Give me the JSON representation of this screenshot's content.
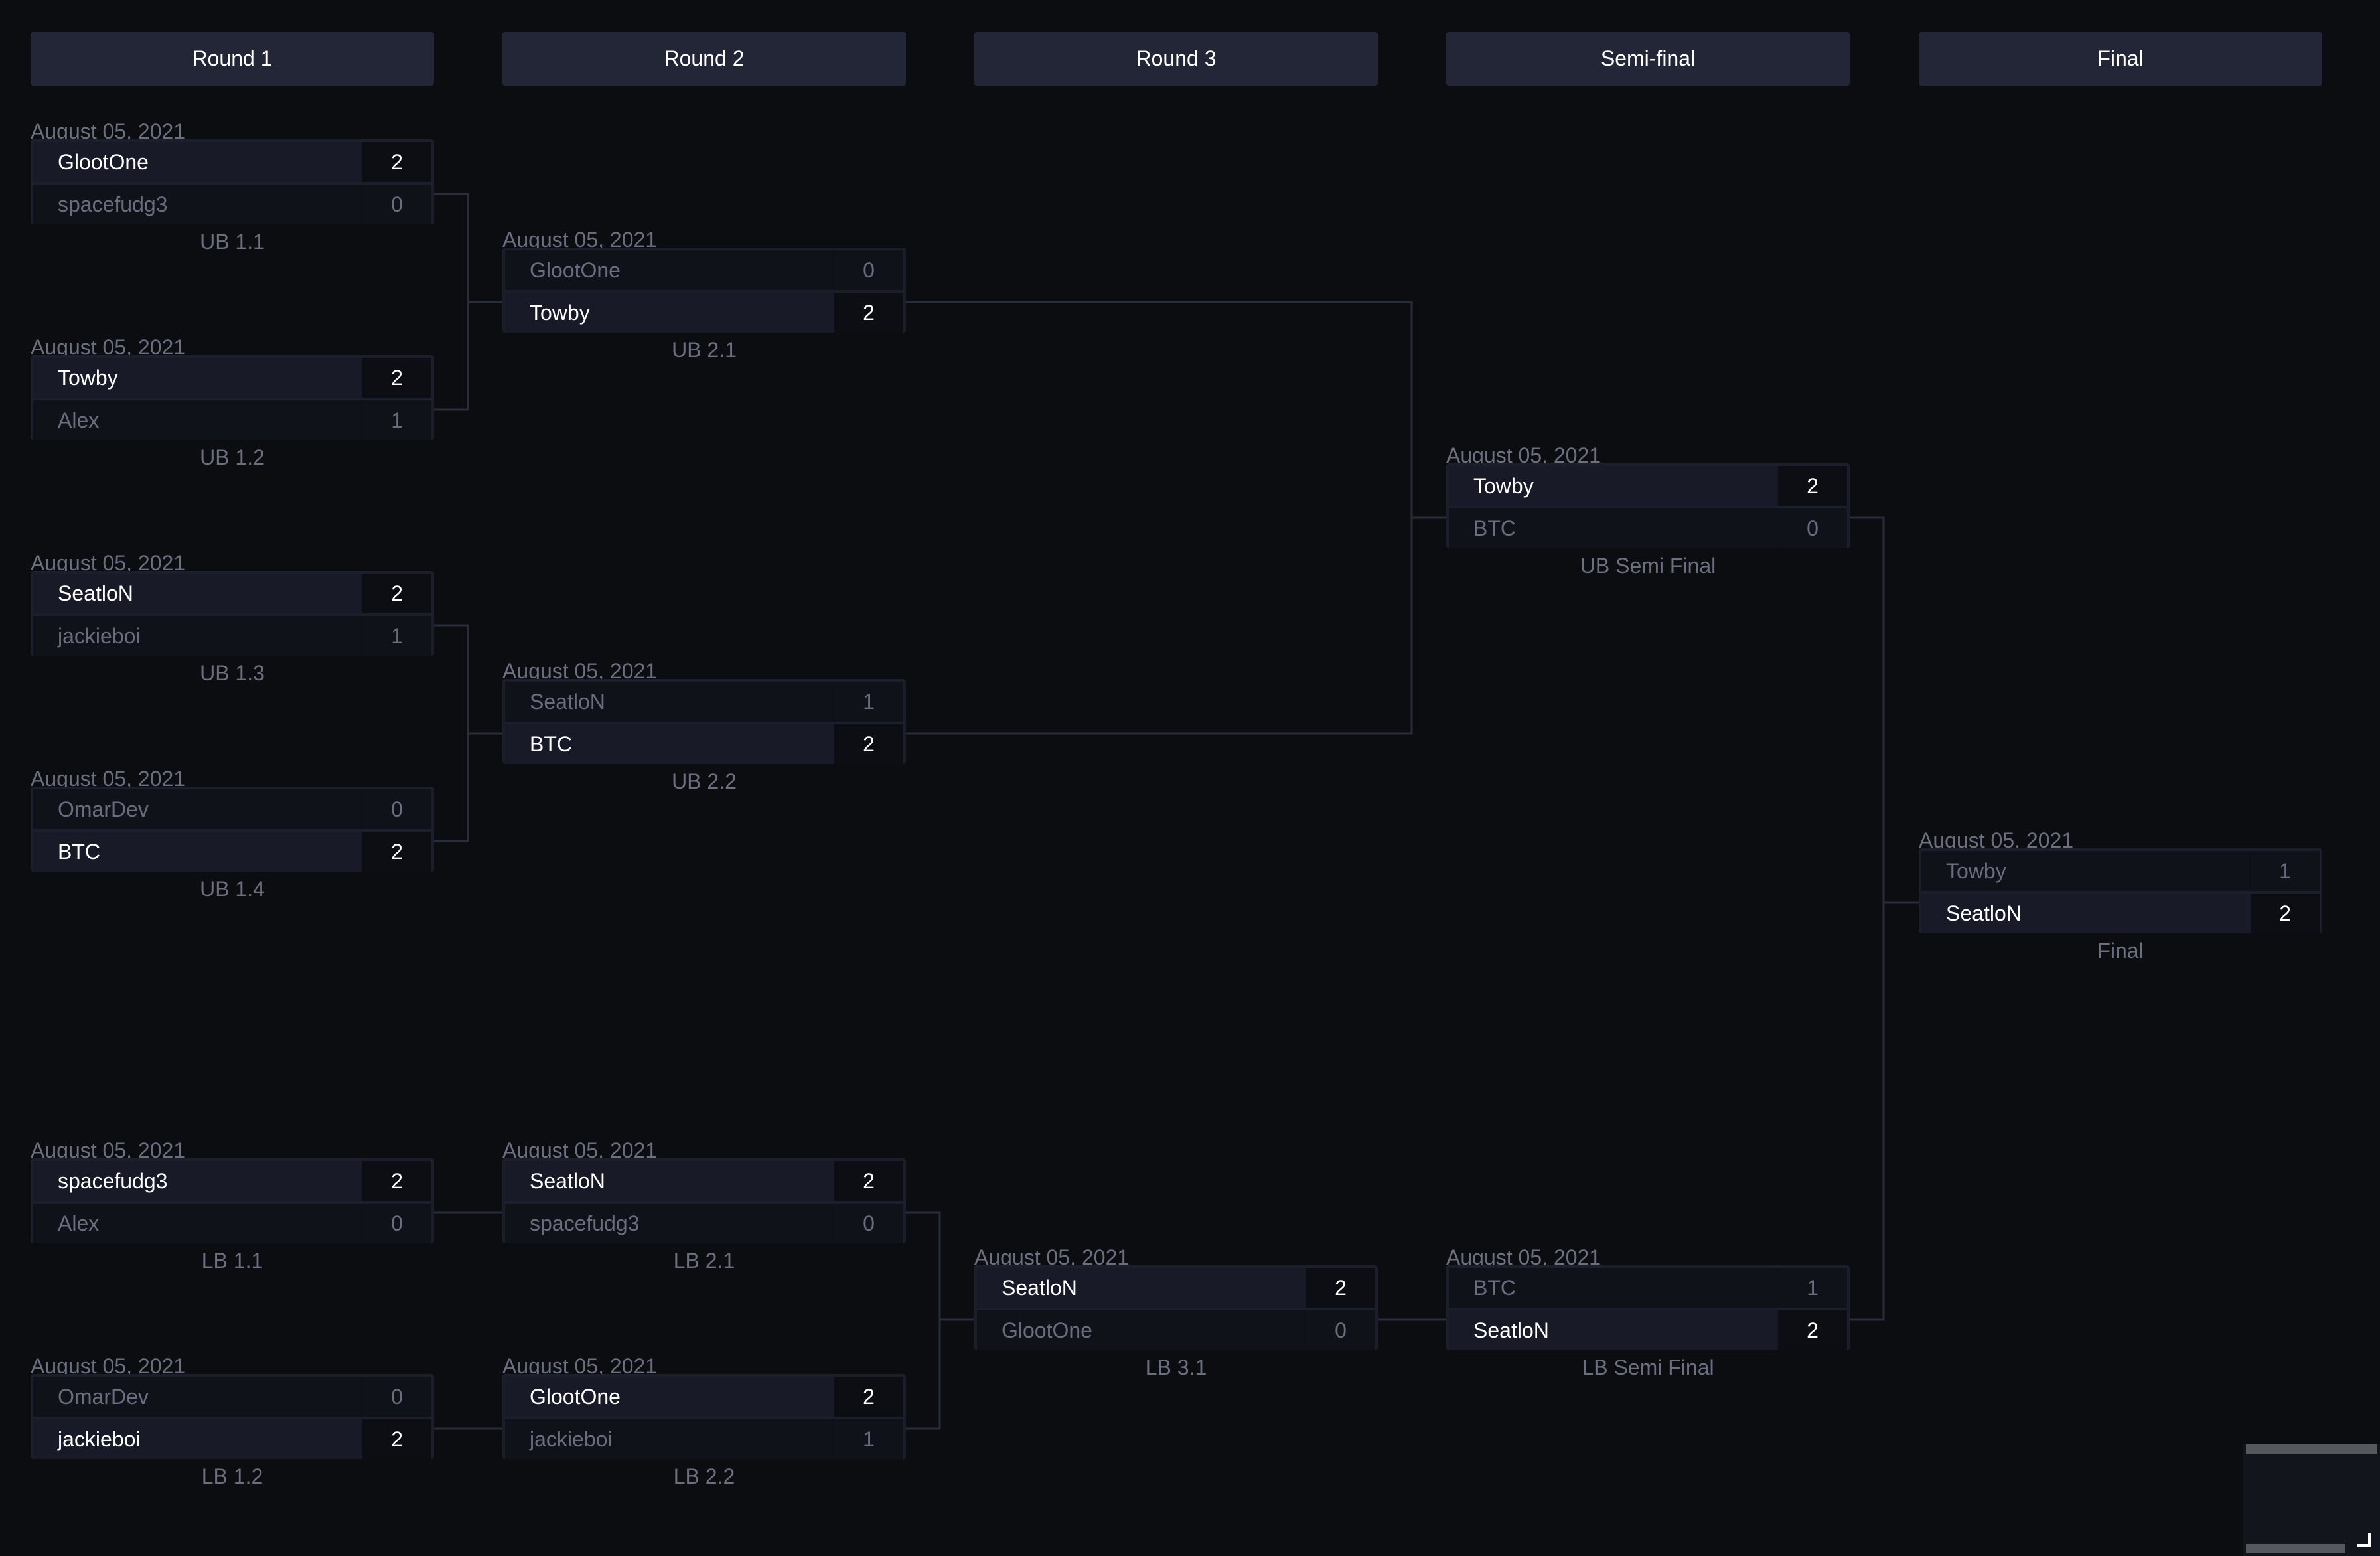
{
  "rounds": [
    "Round 1",
    "Round 2",
    "Round 3",
    "Semi-final",
    "Final"
  ],
  "matches": {
    "ub11": {
      "date": "August 05, 2021",
      "label": "UB 1.1",
      "p1": {
        "name": "GlootOne",
        "score": "2",
        "win": true
      },
      "p2": {
        "name": "spacefudg3",
        "score": "0",
        "win": false
      }
    },
    "ub12": {
      "date": "August 05, 2021",
      "label": "UB 1.2",
      "p1": {
        "name": "Towby",
        "score": "2",
        "win": true
      },
      "p2": {
        "name": "Alex",
        "score": "1",
        "win": false
      }
    },
    "ub13": {
      "date": "August 05, 2021",
      "label": "UB 1.3",
      "p1": {
        "name": "SeatloN",
        "score": "2",
        "win": true
      },
      "p2": {
        "name": "jackieboi",
        "score": "1",
        "win": false
      }
    },
    "ub14": {
      "date": "August 05, 2021",
      "label": "UB 1.4",
      "p1": {
        "name": "OmarDev",
        "score": "0",
        "win": false
      },
      "p2": {
        "name": "BTC",
        "score": "2",
        "win": true
      }
    },
    "ub21": {
      "date": "August 05, 2021",
      "label": "UB 2.1",
      "p1": {
        "name": "GlootOne",
        "score": "0",
        "win": false
      },
      "p2": {
        "name": "Towby",
        "score": "2",
        "win": true
      }
    },
    "ub22": {
      "date": "August 05, 2021",
      "label": "UB 2.2",
      "p1": {
        "name": "SeatloN",
        "score": "1",
        "win": false
      },
      "p2": {
        "name": "BTC",
        "score": "2",
        "win": true
      }
    },
    "ubsf": {
      "date": "August 05, 2021",
      "label": "UB Semi Final",
      "p1": {
        "name": "Towby",
        "score": "2",
        "win": true
      },
      "p2": {
        "name": "BTC",
        "score": "0",
        "win": false
      }
    },
    "final": {
      "date": "August 05, 2021",
      "label": "Final",
      "p1": {
        "name": "Towby",
        "score": "1",
        "win": false
      },
      "p2": {
        "name": "SeatloN",
        "score": "2",
        "win": true
      }
    },
    "lb11": {
      "date": "August 05, 2021",
      "label": "LB 1.1",
      "p1": {
        "name": "spacefudg3",
        "score": "2",
        "win": true
      },
      "p2": {
        "name": "Alex",
        "score": "0",
        "win": false
      }
    },
    "lb12": {
      "date": "August 05, 2021",
      "label": "LB 1.2",
      "p1": {
        "name": "OmarDev",
        "score": "0",
        "win": false
      },
      "p2": {
        "name": "jackieboi",
        "score": "2",
        "win": true
      }
    },
    "lb21": {
      "date": "August 05, 2021",
      "label": "LB 2.1",
      "p1": {
        "name": "SeatloN",
        "score": "2",
        "win": true
      },
      "p2": {
        "name": "spacefudg3",
        "score": "0",
        "win": false
      }
    },
    "lb22": {
      "date": "August 05, 2021",
      "label": "LB 2.2",
      "p1": {
        "name": "GlootOne",
        "score": "2",
        "win": true
      },
      "p2": {
        "name": "jackieboi",
        "score": "1",
        "win": false
      }
    },
    "lb31": {
      "date": "August 05, 2021",
      "label": "LB 3.1",
      "p1": {
        "name": "SeatloN",
        "score": "2",
        "win": true
      },
      "p2": {
        "name": "GlootOne",
        "score": "0",
        "win": false
      }
    },
    "lbsf": {
      "date": "August 05, 2021",
      "label": "LB Semi Final",
      "p1": {
        "name": "BTC",
        "score": "1",
        "win": false
      },
      "p2": {
        "name": "SeatloN",
        "score": "2",
        "win": true
      }
    }
  },
  "colors": {
    "background": "#0b0d11",
    "header": "#232637",
    "connector": "#2a2d3b",
    "muted_text": "#6c6f80"
  }
}
